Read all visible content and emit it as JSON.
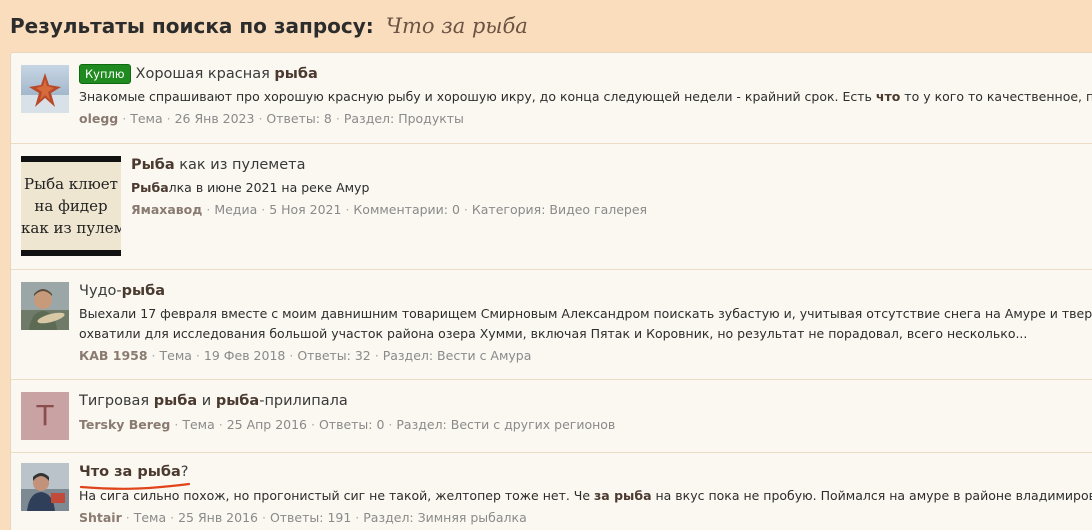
{
  "header": {
    "title": "Результаты поиска по запросу:",
    "query": "Что за рыба"
  },
  "meta_sep": "·",
  "results": [
    {
      "badge": "Куплю",
      "title_parts": [
        "Хорошая красная ",
        "рыба",
        ""
      ],
      "snippet_parts": [
        "Знакомые спрашивают про хорошую красную рыбу и хорошую икру, до конца следующей недели - крайний срок. Есть ",
        "что",
        " то у кого то качественное, по по"
      ],
      "author": "olegg",
      "type": "Тема",
      "date": "26 Янв 2023",
      "stats": "Ответы: 8",
      "section": "Раздел: Продукты"
    },
    {
      "title_parts": [
        "Рыба",
        " как из пулемета",
        ""
      ],
      "snippet_parts": [
        "Рыба",
        "лка в июне 2021 на реке Амур",
        ""
      ],
      "thumb_text": [
        "Рыба клюет",
        "на фидер",
        "как из пулемет"
      ],
      "author": "Ямахавод",
      "type": "Медиа",
      "date": "5 Ноя 2021",
      "stats": "Комментарии: 0",
      "section": "Категория: Видео галерея"
    },
    {
      "title_parts": [
        "Чудо-",
        "рыба",
        ""
      ],
      "snippet_line1": "Выехали 17 февраля вместе с моим давнишним товарищем Смирновым Александром поискать зубастую и, учитывая отсутствие снега на Амуре и твердый к",
      "snippet_line2": "охватили для исследования большой участок района озера Хумми, включая Пятак и Коровник, но результат не порадовал, всего несколько...",
      "author": "КАВ 1958",
      "type": "Тема",
      "date": "19 Фев 2018",
      "stats": "Ответы: 32",
      "section": "Раздел: Вести с Амура"
    },
    {
      "title_parts": [
        "Тигровая ",
        "рыба",
        " и ",
        "рыба",
        "-прилипала"
      ],
      "avatar_letter": "T",
      "author": "Tersky Bereg",
      "type": "Тема",
      "date": "25 Апр 2016",
      "stats": "Ответы: 0",
      "section": "Раздел: Вести с других регионов"
    },
    {
      "title_parts": [
        "Что за рыба",
        "?"
      ],
      "snippet_parts": [
        "На сига сильно похож, но прогонистый сиг не такой, желтопер тоже нет. Че ",
        "за рыба",
        " на вкус пока не пробую. Поймался на амуре в районе владимировки."
      ],
      "author": "Shtair",
      "type": "Тема",
      "date": "25 Янв 2016",
      "stats": "Ответы: 191",
      "section": "Раздел: Зимняя рыбалка"
    }
  ]
}
